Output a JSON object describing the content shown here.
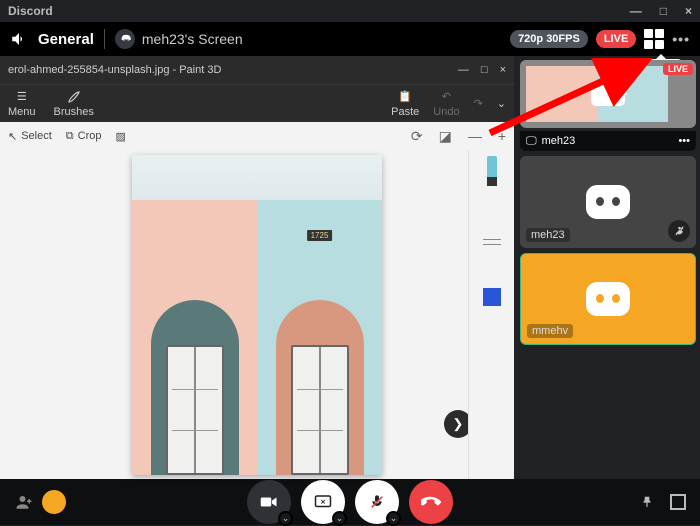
{
  "app": {
    "name": "Discord"
  },
  "header": {
    "channel": "General",
    "stream_owner": "meh23's Screen",
    "quality": "720p 30FPS",
    "live": "LIVE",
    "tooltip": "Grid"
  },
  "paint": {
    "title": "erol-ahmed-255854-unsplash.jpg - Paint 3D",
    "menu": "Menu",
    "brushes": "Brushes",
    "paste": "Paste",
    "undo": "Undo",
    "select": "Select",
    "crop": "Crop",
    "house_right_number": "1725"
  },
  "sidebar": {
    "items": [
      {
        "name": "meh23",
        "live": "LIVE"
      },
      {
        "name": "meh23"
      },
      {
        "name": "mmehv"
      }
    ]
  },
  "colors": {
    "live": "#ed4245",
    "accent_orange": "#f5a623",
    "arrow": "#ff0000"
  }
}
